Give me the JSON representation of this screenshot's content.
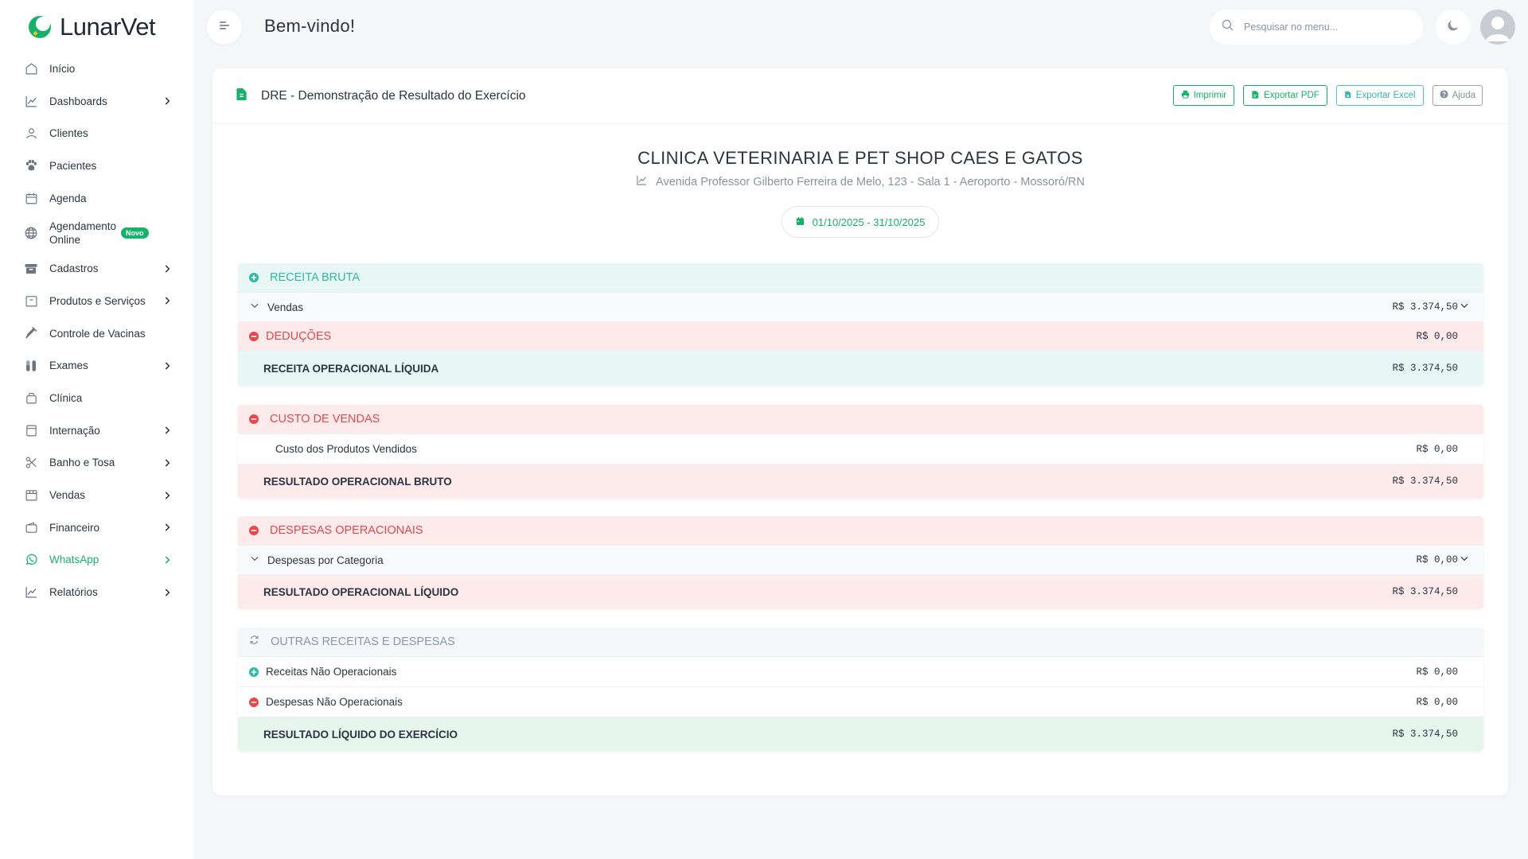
{
  "app": {
    "name": "LunarVet",
    "welcome": "Bem-vindo!",
    "search_placeholder": "Pesquisar no menu...",
    "accent_color": "#17b26a"
  },
  "sidebar": {
    "items": [
      {
        "label": "Início",
        "icon": "home-icon",
        "has_chevron": false
      },
      {
        "label": "Dashboards",
        "icon": "chart-line-icon",
        "has_chevron": true
      },
      {
        "label": "Clientes",
        "icon": "user-icon",
        "has_chevron": false
      },
      {
        "label": "Pacientes",
        "icon": "paw-icon",
        "has_chevron": false
      },
      {
        "label": "Agenda",
        "icon": "calendar-icon",
        "has_chevron": false
      },
      {
        "label": "Agendamento Online",
        "icon": "globe-icon",
        "has_chevron": false,
        "badge": "Novo"
      },
      {
        "label": "Cadastros",
        "icon": "archive-icon",
        "has_chevron": true
      },
      {
        "label": "Produtos e Serviços",
        "icon": "box-icon",
        "has_chevron": true
      },
      {
        "label": "Controle de Vacinas",
        "icon": "syringe-icon",
        "has_chevron": false
      },
      {
        "label": "Exames",
        "icon": "test-tube-icon",
        "has_chevron": true
      },
      {
        "label": "Clínica",
        "icon": "clinic-bag-icon",
        "has_chevron": false
      },
      {
        "label": "Internação",
        "icon": "bed-icon",
        "has_chevron": true
      },
      {
        "label": "Banho e Tosa",
        "icon": "scissors-icon",
        "has_chevron": true
      },
      {
        "label": "Vendas",
        "icon": "store-icon",
        "has_chevron": true
      },
      {
        "label": "Financeiro",
        "icon": "wallet-icon",
        "has_chevron": true
      },
      {
        "label": "WhatsApp",
        "icon": "whatsapp-icon",
        "has_chevron": true,
        "active": true
      },
      {
        "label": "Relatórios",
        "icon": "report-chart-icon",
        "has_chevron": true
      }
    ]
  },
  "report": {
    "title": "DRE - Demonstração de Resultado do Exercício",
    "buttons": {
      "print": "Imprimir",
      "pdf": "Exportar PDF",
      "excel": "Exportar Excel",
      "help": "Ajuda"
    },
    "company": "CLINICA VETERINARIA  E PET SHOP CAES E GATOS",
    "address": "Avenida Professor Gilberto Ferreira de Melo, 123 - Sala 1 - Aeroporto - Mossoró/RN",
    "period": "01/10/2025 - 31/10/2025"
  },
  "sections": {
    "receita": {
      "header": "RECEITA BRUTA",
      "vendas_label": "Vendas",
      "vendas_value": "R$ 3.374,50",
      "deducoes_label": "DEDUÇÕES",
      "deducoes_value": "R$ 0,00",
      "total_label": "RECEITA OPERACIONAL LÍQUIDA",
      "total_value": "R$ 3.374,50"
    },
    "custo": {
      "header": "CUSTO DE VENDAS",
      "cpv_label": "Custo dos Produtos Vendidos",
      "cpv_value": "R$ 0,00",
      "total_label": "RESULTADO OPERACIONAL BRUTO",
      "total_value": "R$ 3.374,50"
    },
    "despesas": {
      "header": "DESPESAS OPERACIONAIS",
      "cat_label": "Despesas por Categoria",
      "cat_value": "R$ 0,00",
      "total_label": "RESULTADO OPERACIONAL LÍQUIDO",
      "total_value": "R$ 3.374,50"
    },
    "outras": {
      "header": "OUTRAS RECEITAS E DESPESAS",
      "rec_label": "Receitas Não Operacionais",
      "rec_value": "R$ 0,00",
      "desp_label": "Despesas Não Operacionais",
      "desp_value": "R$ 0,00",
      "total_label": "RESULTADO LÍQUIDO DO EXERCÍCIO",
      "total_value": "R$ 3.374,50"
    }
  }
}
